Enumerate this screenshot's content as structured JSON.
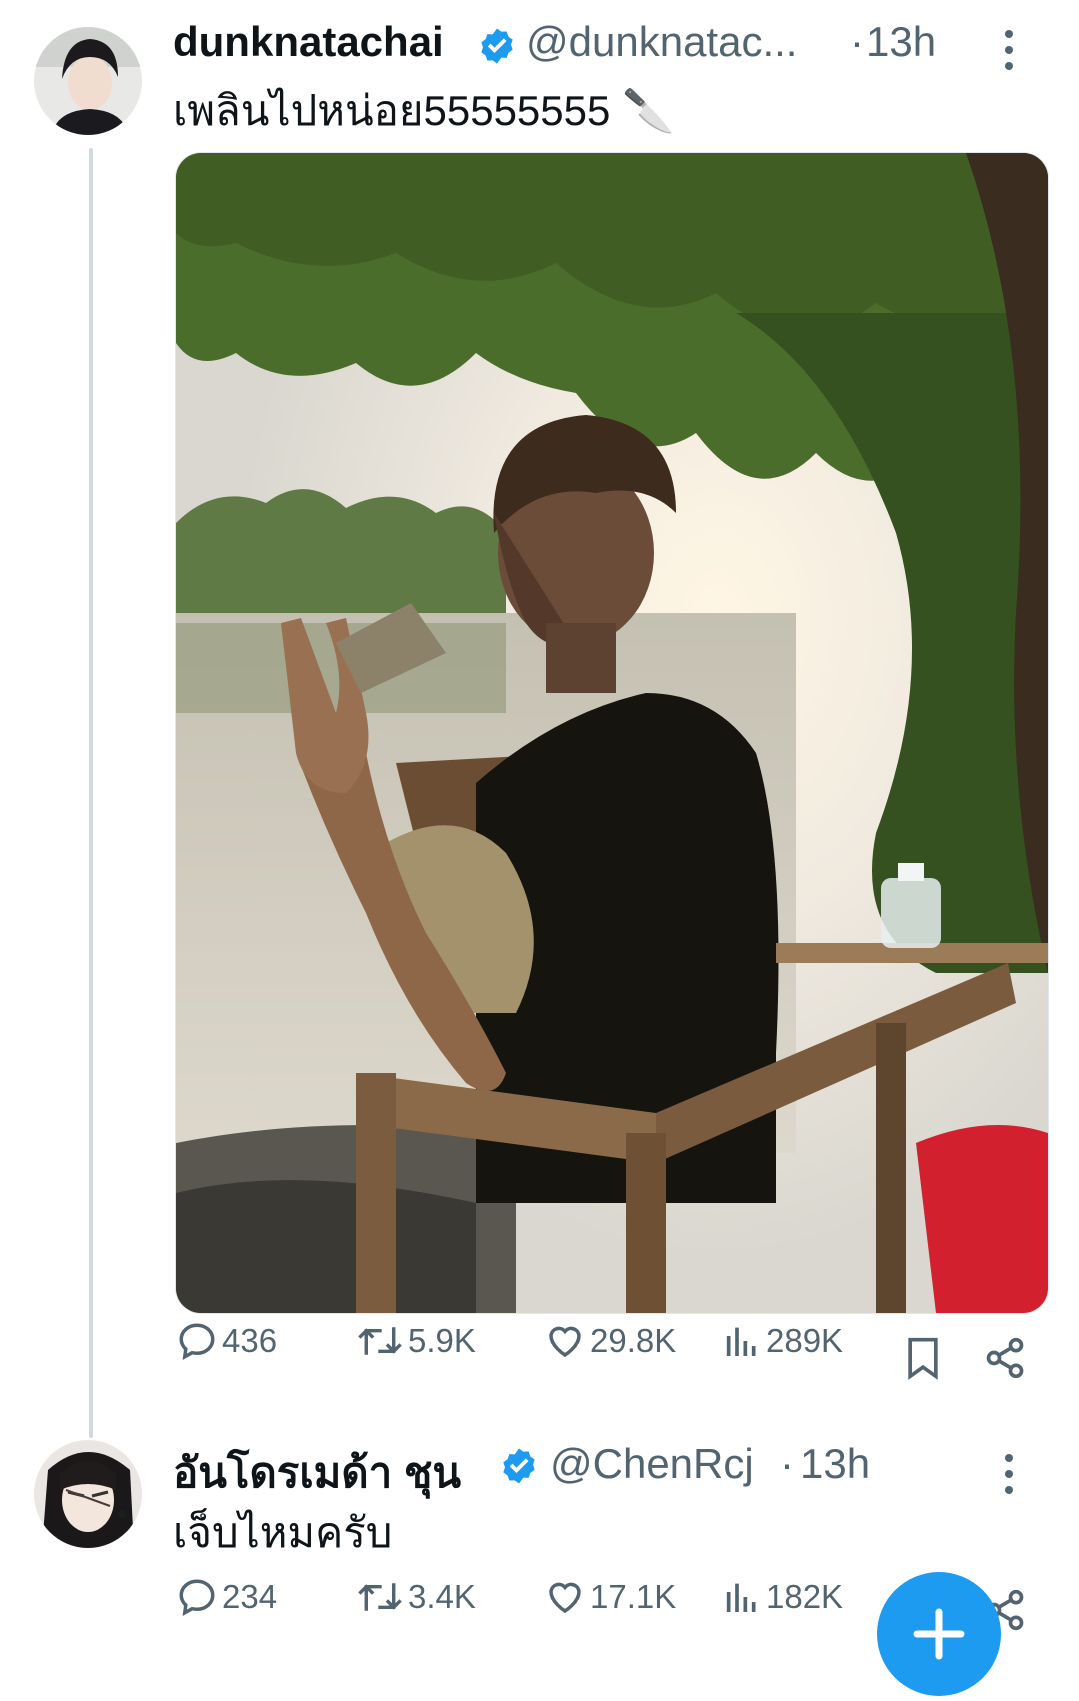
{
  "tweet": {
    "display_name": "dunknatachai",
    "handle": "@dunknatac...",
    "separator": "·",
    "time": "13h",
    "text": "เพลินไปหน่อย55555555 🔪",
    "stats": {
      "replies": "436",
      "retweets": "5.9K",
      "likes": "29.8K",
      "views": "289K"
    },
    "icons": {
      "verified": "verified-badge-icon",
      "more": "more-vertical-icon",
      "reply": "reply-icon",
      "retweet": "retweet-icon",
      "like": "heart-icon",
      "views": "views-icon",
      "bookmark": "bookmark-icon",
      "share": "share-icon"
    }
  },
  "reply": {
    "display_name": "อันโดรเมด้า ชุน",
    "handle": "@ChenRcj",
    "separator": "·",
    "time": "13h",
    "text": "เจ็บไหมครับ",
    "stats": {
      "replies": "234",
      "retweets": "3.4K",
      "likes": "17.1K",
      "views": "182K"
    }
  },
  "colors": {
    "accent": "#1d9bf0",
    "secondary_text": "#536471",
    "primary_text": "#0f1419",
    "thread_line": "#cfd9de"
  }
}
